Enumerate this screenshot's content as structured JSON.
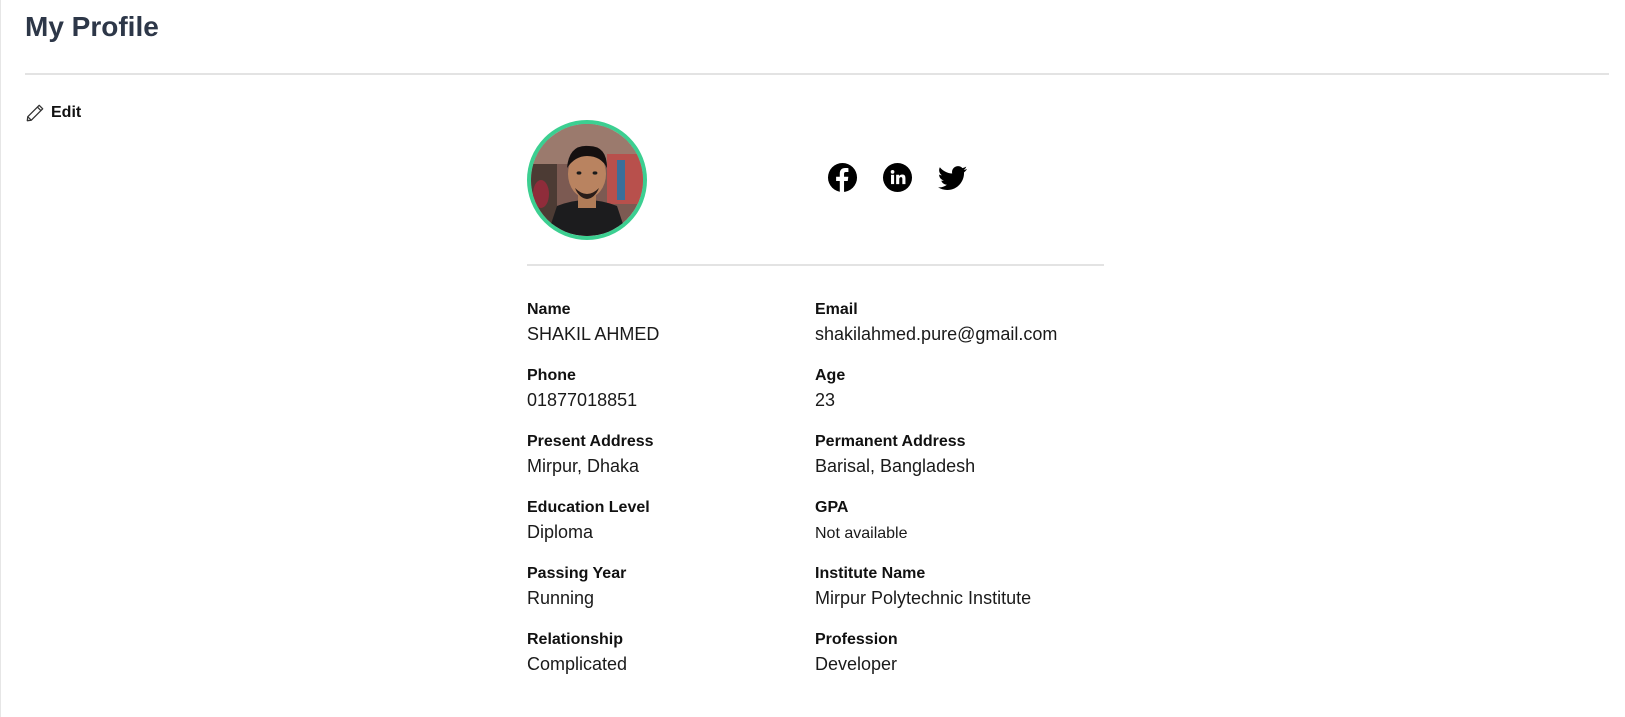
{
  "header": {
    "title": "My Profile"
  },
  "actions": {
    "edit_label": "Edit"
  },
  "profile": {
    "social": [
      "facebook-icon",
      "linkedin-icon",
      "twitter-icon"
    ],
    "accent_color": "#3ccf91",
    "fields": {
      "name": {
        "label": "Name",
        "value": "SHAKIL AHMED"
      },
      "email": {
        "label": "Email",
        "value": "shakilahmed.pure@gmail.com"
      },
      "phone": {
        "label": "Phone",
        "value": "01877018851"
      },
      "age": {
        "label": "Age",
        "value": "23"
      },
      "present_address": {
        "label": "Present Address",
        "value": "Mirpur, Dhaka"
      },
      "permanent_address": {
        "label": "Permanent Address",
        "value": "Barisal, Bangladesh"
      },
      "education_level": {
        "label": "Education Level",
        "value": "Diploma"
      },
      "gpa": {
        "label": "GPA",
        "value": "Not available"
      },
      "passing_year": {
        "label": "Passing Year",
        "value": "Running"
      },
      "institute_name": {
        "label": "Institute Name",
        "value": "Mirpur Polytechnic Institute"
      },
      "relationship": {
        "label": "Relationship",
        "value": "Complicated"
      },
      "profession": {
        "label": "Profession",
        "value": "Developer"
      }
    }
  }
}
